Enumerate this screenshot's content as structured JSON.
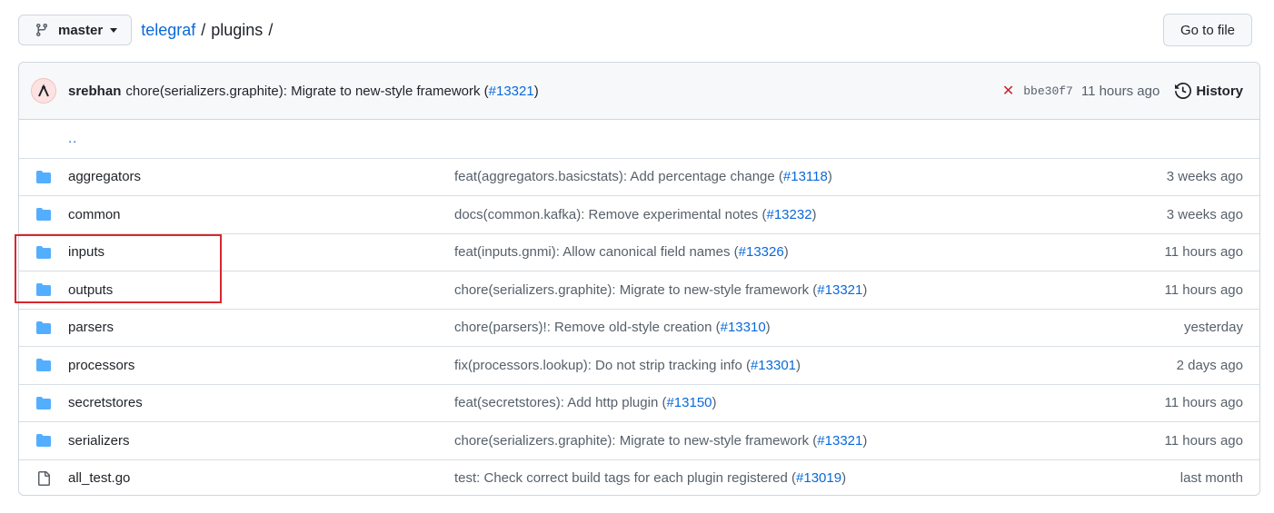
{
  "header": {
    "branch": "master",
    "repo": "telegraf",
    "sep1": "/",
    "path": "plugins",
    "sep2": "/",
    "goto_file": "Go to file"
  },
  "commit": {
    "author": "srebhan",
    "message": "chore(serializers.graphite): Migrate to new-style framework (",
    "pr": "#13321",
    "message_end": ")",
    "status_icon": "x-fail-icon",
    "sha": "bbe30f7",
    "time": "11 hours ago",
    "history": "History"
  },
  "updir": "..",
  "files": [
    {
      "type": "dir",
      "name": "aggregators",
      "msg": "feat(aggregators.basicstats): Add percentage change (",
      "pr": "#13118",
      "end": ")",
      "time": "3 weeks ago"
    },
    {
      "type": "dir",
      "name": "common",
      "msg": "docs(common.kafka): Remove experimental notes (",
      "pr": "#13232",
      "end": ")",
      "time": "3 weeks ago"
    },
    {
      "type": "dir",
      "name": "inputs",
      "msg": "feat(inputs.gnmi): Allow canonical field names (",
      "pr": "#13326",
      "end": ")",
      "time": "11 hours ago"
    },
    {
      "type": "dir",
      "name": "outputs",
      "msg": "chore(serializers.graphite): Migrate to new-style framework (",
      "pr": "#13321",
      "end": ")",
      "time": "11 hours ago"
    },
    {
      "type": "dir",
      "name": "parsers",
      "msg": "chore(parsers)!: Remove old-style creation (",
      "pr": "#13310",
      "end": ")",
      "time": "yesterday"
    },
    {
      "type": "dir",
      "name": "processors",
      "msg": "fix(processors.lookup): Do not strip tracking info (",
      "pr": "#13301",
      "end": ")",
      "time": "2 days ago"
    },
    {
      "type": "dir",
      "name": "secretstores",
      "msg": "feat(secretstores): Add http plugin (",
      "pr": "#13150",
      "end": ")",
      "time": "11 hours ago"
    },
    {
      "type": "dir",
      "name": "serializers",
      "msg": "chore(serializers.graphite): Migrate to new-style framework (",
      "pr": "#13321",
      "end": ")",
      "time": "11 hours ago"
    },
    {
      "type": "file",
      "name": "all_test.go",
      "msg": "test: Check correct build tags for each plugin registered (",
      "pr": "#13019",
      "end": ")",
      "time": "last month"
    }
  ],
  "colors": {
    "link": "#0969da",
    "folder": "#54aeff",
    "fail": "#cf222e",
    "highlight": "#d9262e"
  }
}
